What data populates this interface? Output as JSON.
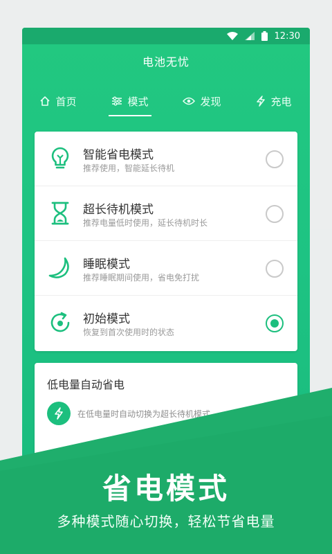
{
  "status_bar": {
    "time": "12:30"
  },
  "app": {
    "title": "电池无忧"
  },
  "tabs": [
    {
      "label": "首页",
      "icon": "home-icon"
    },
    {
      "label": "模式",
      "icon": "sliders-icon",
      "active": true
    },
    {
      "label": "发现",
      "icon": "eye-icon"
    },
    {
      "label": "充电",
      "icon": "bolt-icon"
    }
  ],
  "modes": [
    {
      "title": "智能省电模式",
      "desc": "推荐使用，智能延长待机",
      "icon": "lightbulb-icon",
      "selected": false
    },
    {
      "title": "超长待机模式",
      "desc": "推荐电量低时使用，延长待机时长",
      "icon": "hourglass-icon",
      "selected": false
    },
    {
      "title": "睡眠模式",
      "desc": "推荐睡眠期间使用，省电免打扰",
      "icon": "moon-icon",
      "selected": false
    },
    {
      "title": "初始模式",
      "desc": "恢复到首次使用时的状态",
      "icon": "restore-icon",
      "selected": true
    }
  ],
  "low_power": {
    "title": "低电量自动省电",
    "desc": "在低电量时自动切换为超长待机模式",
    "icon": "bolt-icon"
  },
  "promo": {
    "title": "省电模式",
    "subtitle": "多种模式随心切换，轻松节省电量"
  },
  "colors": {
    "brand": "#1cbf7e",
    "header": "#22c880",
    "status_bar": "#1aaa6d",
    "promo_band": "#1fae6c"
  }
}
